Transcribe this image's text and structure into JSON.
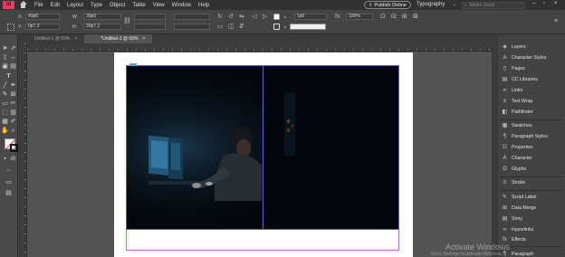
{
  "app": {
    "logo_text": "Id"
  },
  "menu": {
    "items": [
      "File",
      "Edit",
      "Layout",
      "Type",
      "Object",
      "Table",
      "View",
      "Window",
      "Help"
    ],
    "publish_label": "Publish Online",
    "workspace_label": "Typography",
    "search_placeholder": "Adobe Stock"
  },
  "control": {
    "x_label": "X:",
    "x_value": "43p6",
    "y_label": "Y:",
    "y_value": "0p7.2",
    "w_label": "W:",
    "w_value": "39p0",
    "h_label": "H:",
    "h_value": "29p7.2",
    "stroke_value": "1p0",
    "percent_value": "100%"
  },
  "doc_tabs": [
    {
      "label": "Untitled-1 @ 59%",
      "close": "×",
      "active": false
    },
    {
      "label": "*Untitled-2 @ 69%",
      "close": "×",
      "active": true
    }
  ],
  "panels": [
    {
      "label": "Layers",
      "icon": "layers-icon",
      "glyph": "◈"
    },
    {
      "label": "Character Styles",
      "icon": "character-styles-icon",
      "glyph": "A"
    },
    {
      "label": "Pages",
      "icon": "pages-icon",
      "glyph": "▯"
    },
    {
      "label": "CC Libraries",
      "icon": "cc-libraries-icon",
      "glyph": "▤"
    },
    {
      "label": "Links",
      "icon": "links-icon",
      "glyph": "∞"
    },
    {
      "label": "Text Wrap",
      "icon": "text-wrap-icon",
      "glyph": "≡"
    },
    {
      "label": "Pathfinder",
      "icon": "pathfinder-icon",
      "glyph": "◧"
    },
    {
      "label": "Swatches",
      "icon": "swatches-icon",
      "glyph": "▦"
    },
    {
      "label": "Paragraph Styles",
      "icon": "paragraph-styles-icon",
      "glyph": "¶"
    },
    {
      "label": "Properties",
      "icon": "properties-icon",
      "glyph": "☷"
    },
    {
      "label": "Character",
      "icon": "character-icon",
      "glyph": "A"
    },
    {
      "label": "Glyphs",
      "icon": "glyphs-icon",
      "glyph": "Ω"
    },
    {
      "label": "Stroke",
      "icon": "stroke-icon",
      "glyph": "≡"
    },
    {
      "label": "Script Label",
      "icon": "script-label-icon",
      "glyph": "✎"
    },
    {
      "label": "Data Merge",
      "icon": "data-merge-icon",
      "glyph": "⊞"
    },
    {
      "label": "Story",
      "icon": "story-icon",
      "glyph": "▤"
    },
    {
      "label": "Hyperlinks",
      "icon": "hyperlinks-icon",
      "glyph": "∞"
    },
    {
      "label": "Effects",
      "icon": "effects-icon",
      "glyph": "fx"
    },
    {
      "label": "Paragraph",
      "icon": "paragraph-icon",
      "glyph": "¶"
    }
  ],
  "watermark": {
    "title": "Activate Windows",
    "subtitle": "Go to Settings to activate Windows."
  },
  "colors": {
    "accent": "#ff3366",
    "frame_edge": "#6b5bd0",
    "margin_guide": "#c86ad0"
  }
}
